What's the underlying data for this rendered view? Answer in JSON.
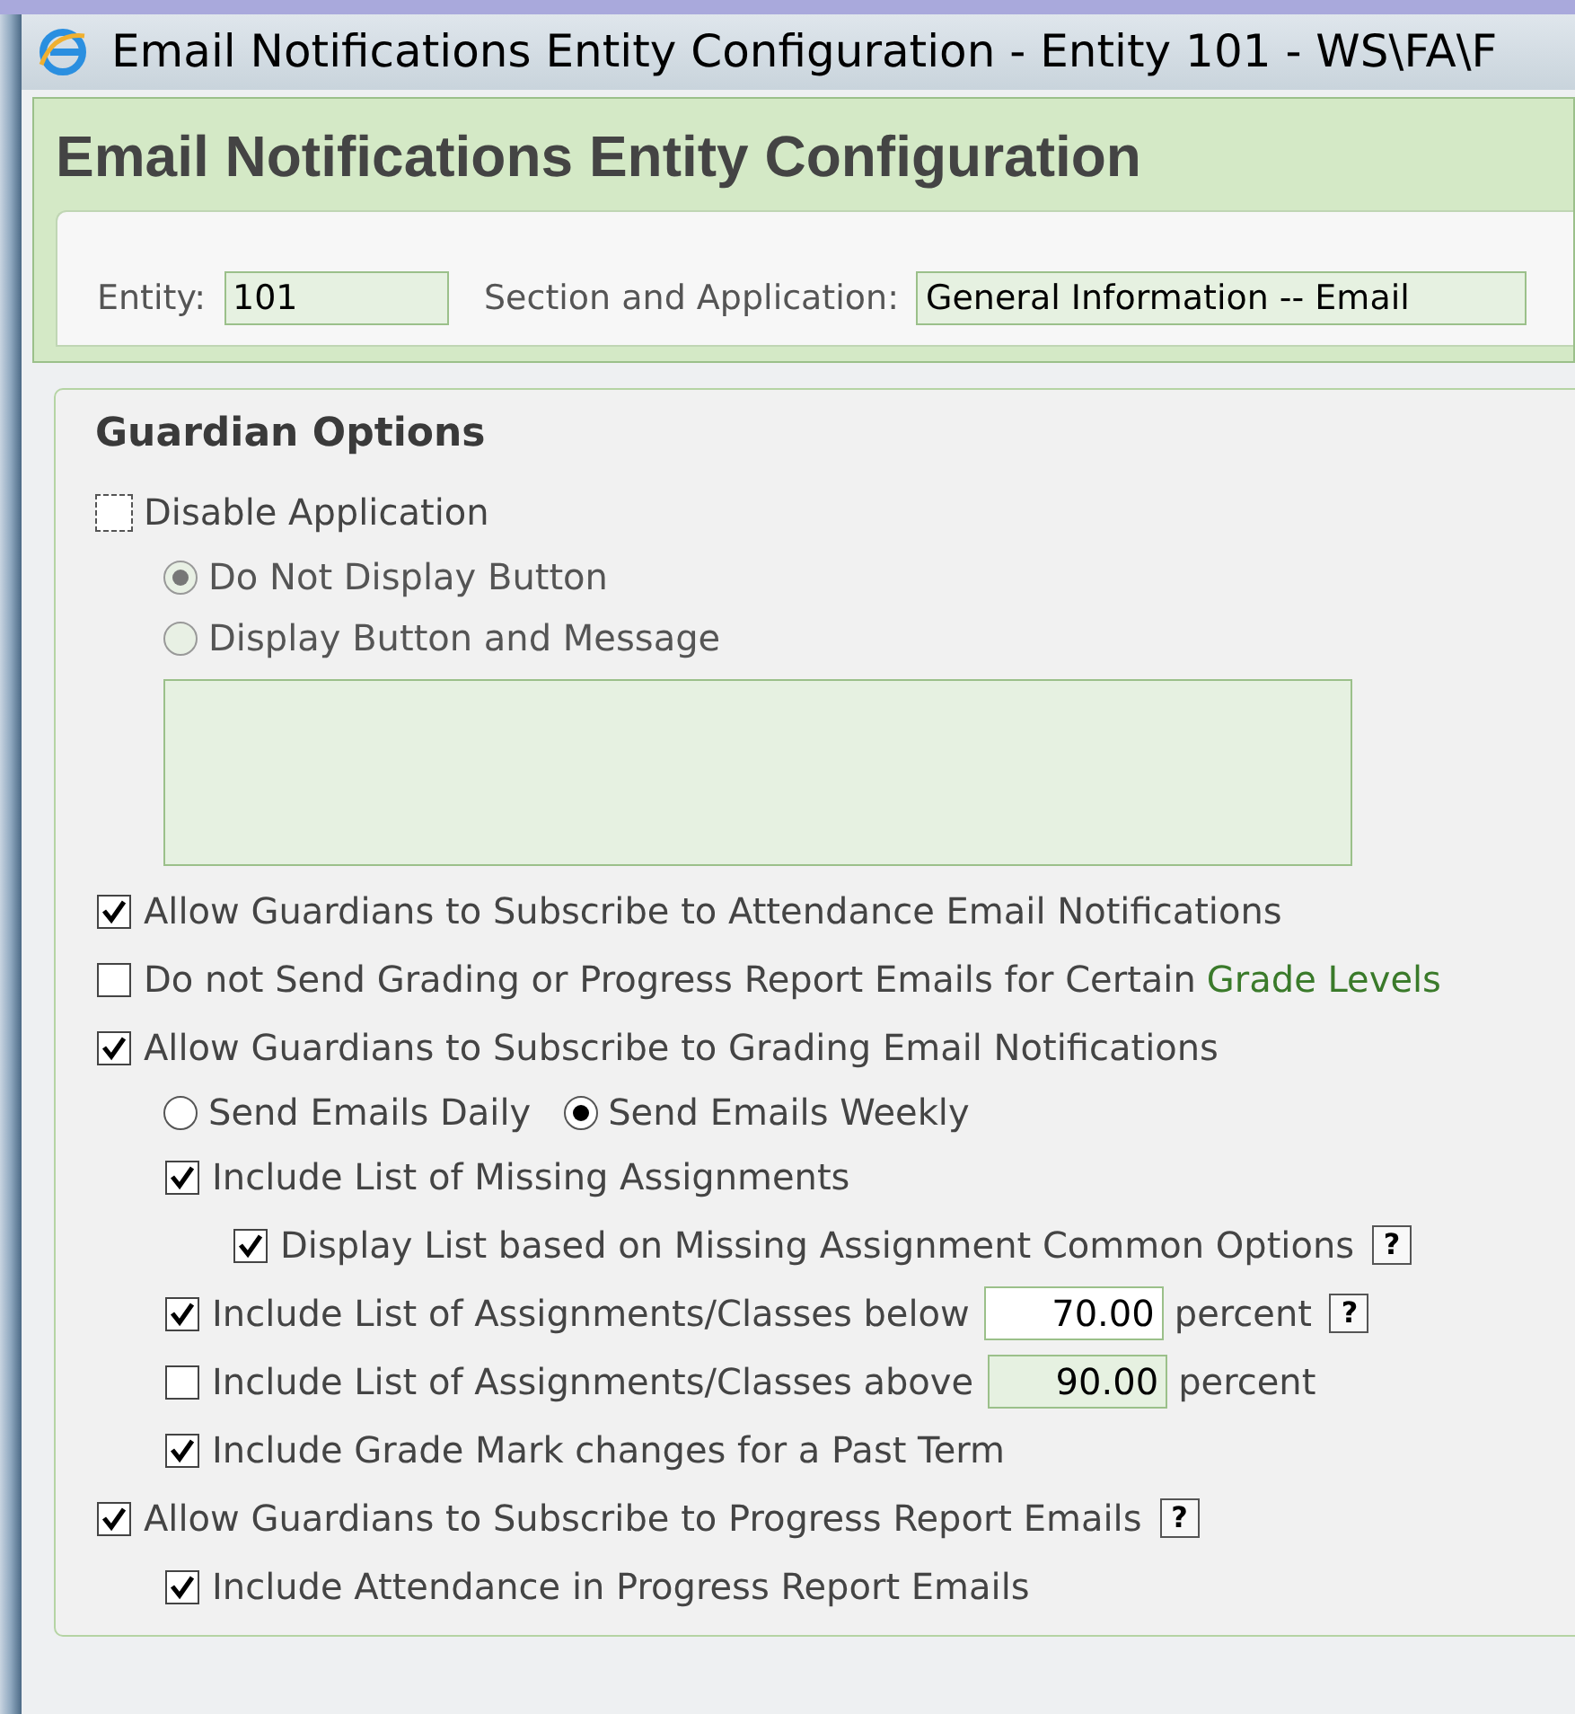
{
  "window": {
    "title": "Email Notifications Entity Configuration - Entity 101 - WS\\FA\\F"
  },
  "header": {
    "title": "Email Notifications Entity Configuration"
  },
  "entity_bar": {
    "entity_label": "Entity:",
    "entity_value": "101",
    "section_label": "Section and Application:",
    "section_value": "General Information -- Email"
  },
  "guardian_options": {
    "title": "Guardian Options",
    "items": [
      {
        "kind": "checkbox",
        "label": "Disable Application",
        "checked": false,
        "focused": true,
        "children": [
          {
            "kind": "radio_group",
            "options": [
              {
                "label": "Do Not Display Button",
                "selected": true,
                "disabled": true
              },
              {
                "label": "Display Button and Message",
                "selected": false,
                "disabled": true
              }
            ]
          },
          {
            "kind": "text_area"
          }
        ]
      },
      {
        "kind": "checkbox",
        "label": "Allow Guardians to Subscribe to Attendance Email Notifications",
        "checked": true,
        "focused": false
      },
      {
        "kind": "checkbox",
        "label": "Do not Send Grading or Progress Report Emails for Certain",
        "link": "Grade Levels",
        "checked": false,
        "focused": false
      },
      {
        "kind": "checkbox",
        "label": "Allow Guardians to Subscribe to Grading Email Notifications",
        "checked": true,
        "focused": false,
        "children": [
          {
            "kind": "radio_group",
            "options": [
              {
                "label": "Send Emails Daily",
                "selected": false,
                "disabled": false
              },
              {
                "label": "Send Emails Weekly",
                "selected": true,
                "disabled": false
              }
            ]
          },
          {
            "kind": "checkbox",
            "label": "Include List of Missing Assignments",
            "checked": true,
            "focused": false,
            "children": [
              {
                "kind": "checkbox",
                "label": "Display List based on Missing Assignment Common Options",
                "checked": true,
                "focused": false,
                "help": "?"
              }
            ]
          },
          {
            "kind": "checkbox",
            "label": "Include List of Assignments/Classes below",
            "checked": true,
            "focused": false,
            "field": {
              "value": "70.00",
              "disabled": false
            },
            "suffix": "percent",
            "help": "?"
          },
          {
            "kind": "checkbox",
            "label": "Include List of Assignments/Classes above",
            "checked": false,
            "focused": false,
            "field": {
              "value": "90.00",
              "disabled": true
            },
            "suffix": "percent"
          },
          {
            "kind": "checkbox",
            "label": "Include Grade Mark changes for a Past Term",
            "checked": true,
            "focused": false
          }
        ]
      },
      {
        "kind": "checkbox",
        "label": "Allow Guardians to Subscribe to Progress Report Emails",
        "checked": true,
        "focused": false,
        "help": "?",
        "children": [
          {
            "kind": "checkbox",
            "label": "Include Attendance in Progress Report Emails",
            "checked": true,
            "focused": false
          }
        ]
      }
    ]
  }
}
